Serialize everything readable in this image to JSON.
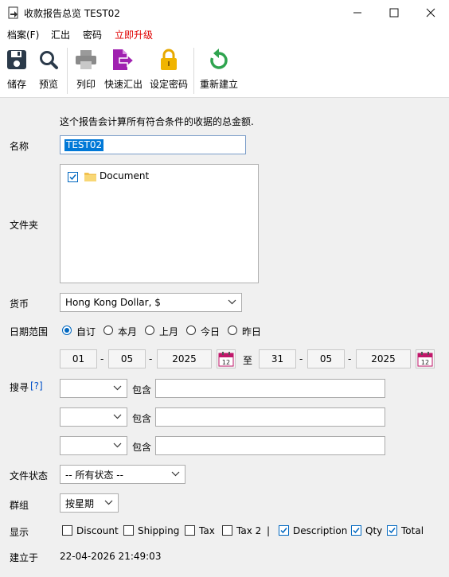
{
  "window": {
    "title": "收款报告总览 TEST02"
  },
  "menu": {
    "file": "档案(F)",
    "export": "汇出",
    "password": "密码",
    "upgrade": "立即升级"
  },
  "toolbar": {
    "save": "储存",
    "preview": "预览",
    "print": "列印",
    "quick_export": "快速汇出",
    "set_password": "设定密码",
    "rebuild": "重新建立"
  },
  "form": {
    "description": "这个报告会计算所有符合条件的收据的总金额.",
    "name_label": "名称",
    "name_value": "TEST02",
    "folder_label": "文件夹",
    "folder_item": "Document",
    "currency_label": "货币",
    "currency_value": "Hong Kong Dollar, $",
    "date_range_label": "日期范围",
    "date_options": [
      "自订",
      "本月",
      "上月",
      "今日",
      "昨日"
    ],
    "date_from": {
      "day": "01",
      "month": "05",
      "year": "2025"
    },
    "date_to_label": "至",
    "date_to": {
      "day": "31",
      "month": "05",
      "year": "2025"
    },
    "date_separator": "-",
    "calendar_day": "12",
    "search_label": "搜寻",
    "search_help": "[?]",
    "contains_label": "包含",
    "status_label": "文件状态",
    "status_value": "-- 所有状态 --",
    "group_label": "群组",
    "group_value": "按星期",
    "display_label": "显示",
    "display_options": [
      {
        "label": "Discount",
        "checked": false
      },
      {
        "label": "Shipping",
        "checked": false
      },
      {
        "label": "Tax",
        "checked": false
      },
      {
        "label": "Tax 2",
        "checked": false
      },
      {
        "label": "Description",
        "checked": true
      },
      {
        "label": "Qty",
        "checked": true
      },
      {
        "label": "Total",
        "checked": true
      }
    ],
    "display_divider": "|",
    "created_label": "建立于",
    "created_value": "22-04-2026 21:49:03"
  },
  "colors": {
    "upgrade": "#e00000",
    "accent": "#0067c0",
    "save": "#2b3a4a",
    "export": "#a020b0",
    "lock": "#e6a800",
    "rebuild": "#2fa44f",
    "calendar": "#c0176a"
  }
}
